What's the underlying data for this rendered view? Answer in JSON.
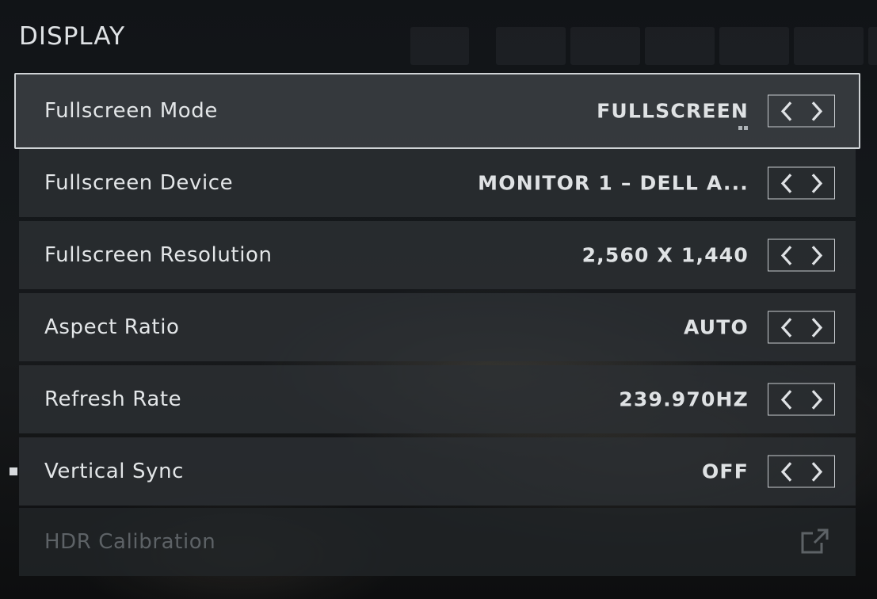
{
  "section": {
    "title": "DISPLAY"
  },
  "rows": [
    {
      "label": "Fullscreen Mode",
      "value": "FULLSCREEN"
    },
    {
      "label": "Fullscreen Device",
      "value": "MONITOR 1 – DELL A..."
    },
    {
      "label": "Fullscreen Resolution",
      "value": "2,560 X 1,440"
    },
    {
      "label": "Aspect Ratio",
      "value": "AUTO"
    },
    {
      "label": "Refresh Rate",
      "value": "239.970HZ"
    },
    {
      "label": "Vertical Sync",
      "value": "OFF"
    },
    {
      "label": "HDR Calibration"
    }
  ],
  "icons": {
    "prev": "chevron-left-icon",
    "next": "chevron-right-icon",
    "external": "external-link-icon",
    "modified": "square-bullet-icon"
  },
  "colors": {
    "text": "#e3e6e8",
    "selected_border": "#cfd3d6",
    "disabled_text": "#5d6266"
  }
}
